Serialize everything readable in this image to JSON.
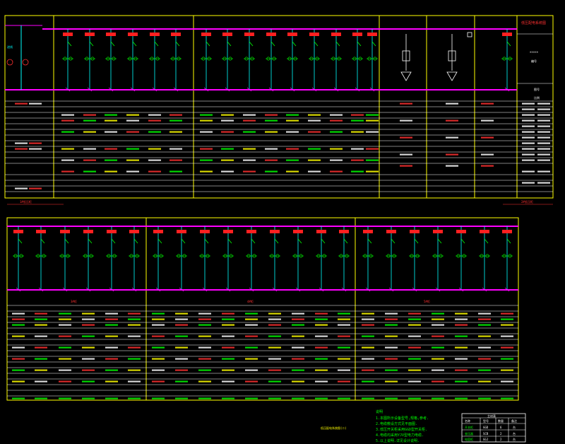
{
  "colors": {
    "background": "#000000",
    "frame": "#ffff00",
    "busbar": "#ff00ff",
    "feeder": "#00ffff",
    "breaker": "#00ff00",
    "tag": "#ff2020",
    "text_white": "#ffffff",
    "text_red": "#ff3030",
    "text_green": "#00ff00",
    "text_yellow": "#ffff00"
  },
  "upper_panel": {
    "right_title_lines": [
      "低压配电系统图",
      "×××××",
      "编号",
      "图号",
      "比例"
    ],
    "row_header_labels": [
      "柜编号",
      "柜型号",
      "回路编号",
      "用途",
      "容量(kW)",
      "计算电流",
      "断路器",
      "电流互感器",
      "电缆型号规格",
      "电缆规格",
      "导线",
      "备注"
    ],
    "left_bus_label": "进线",
    "bottom_left_label": "1#低压柜",
    "bottom_right_label": "2#低压柜"
  },
  "lower_panel": {
    "group_labels": [
      "3#柜",
      "4#柜",
      "5#柜"
    ]
  },
  "notes": {
    "title": "说明",
    "lines": [
      "1.本图所示设备型号,规格,参考.",
      "2.电缆敷设方式见平面图.",
      "3.低压开关柜采用GGD型开关柜.",
      "4.电缆均采用YJV型电力电缆.",
      "5.以上说明.详见设计说明."
    ],
    "caption": "低压配电系统图(二)"
  },
  "legend_table": {
    "title": "主材表",
    "headers": [
      "名称",
      "型号",
      "数量",
      "备注"
    ],
    "rows": [
      [
        "开关柜",
        "GGD",
        "6",
        "台"
      ],
      [
        "变压器",
        "SCB",
        "2",
        "台"
      ],
      [
        "电容柜",
        "GGJ",
        "2",
        "台"
      ]
    ]
  }
}
